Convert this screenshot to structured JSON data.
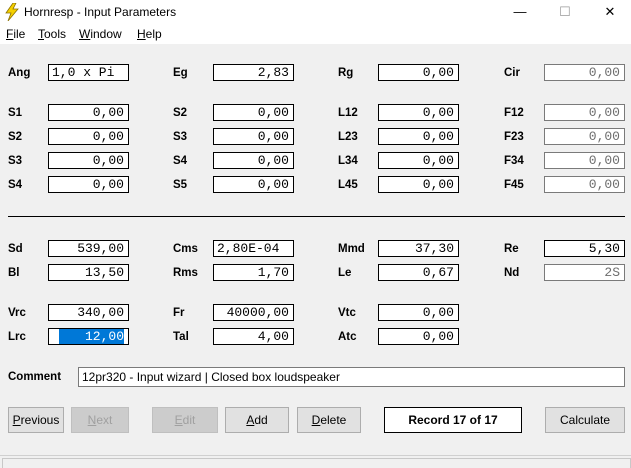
{
  "window": {
    "title": "Hornresp - Input Parameters",
    "minimize": "—",
    "maximize": "☐",
    "close": "✕"
  },
  "menu": [
    "File",
    "Tools",
    "Window",
    "Help"
  ],
  "params": {
    "Ang": {
      "label": "Ang",
      "value": "1,0 x Pi"
    },
    "Eg": {
      "label": "Eg",
      "value": "2,83"
    },
    "Rg": {
      "label": "Rg",
      "value": "0,00"
    },
    "Cir": {
      "label": "Cir",
      "value": "0,00"
    },
    "S1": {
      "label": "S1",
      "value": "0,00"
    },
    "S2a": {
      "label": "S2",
      "value": "0,00"
    },
    "L12": {
      "label": "L12",
      "value": "0,00"
    },
    "F12": {
      "label": "F12",
      "value": "0,00"
    },
    "S2b": {
      "label": "S2",
      "value": "0,00"
    },
    "S3a": {
      "label": "S3",
      "value": "0,00"
    },
    "L23": {
      "label": "L23",
      "value": "0,00"
    },
    "F23": {
      "label": "F23",
      "value": "0,00"
    },
    "S3b": {
      "label": "S3",
      "value": "0,00"
    },
    "S4a": {
      "label": "S4",
      "value": "0,00"
    },
    "L34": {
      "label": "L34",
      "value": "0,00"
    },
    "F34": {
      "label": "F34",
      "value": "0,00"
    },
    "S4b": {
      "label": "S4",
      "value": "0,00"
    },
    "S5": {
      "label": "S5",
      "value": "0,00"
    },
    "L45": {
      "label": "L45",
      "value": "0,00"
    },
    "F45": {
      "label": "F45",
      "value": "0,00"
    },
    "Sd": {
      "label": "Sd",
      "value": "539,00"
    },
    "Cms": {
      "label": "Cms",
      "value": "2,80E-04"
    },
    "Mmd": {
      "label": "Mmd",
      "value": "37,30"
    },
    "Re": {
      "label": "Re",
      "value": "5,30"
    },
    "Bl": {
      "label": "Bl",
      "value": "13,50"
    },
    "Rms": {
      "label": "Rms",
      "value": "1,70"
    },
    "Le": {
      "label": "Le",
      "value": "0,67"
    },
    "Nd": {
      "label": "Nd",
      "value": "2S"
    },
    "Vrc": {
      "label": "Vrc",
      "value": "340,00"
    },
    "Fr": {
      "label": "Fr",
      "value": "40000,00"
    },
    "Vtc": {
      "label": "Vtc",
      "value": "0,00"
    },
    "Lrc": {
      "label": "Lrc",
      "value": "12,00"
    },
    "Tal": {
      "label": "Tal",
      "value": "4,00"
    },
    "Atc": {
      "label": "Atc",
      "value": "0,00"
    }
  },
  "comment": {
    "label": "Comment",
    "value": "12pr320 - Input wizard | Closed box loudspeaker"
  },
  "buttons": {
    "previous": "Previous",
    "next": "Next",
    "edit": "Edit",
    "add": "Add",
    "delete": "Delete",
    "calculate": "Calculate"
  },
  "record": "Record 17 of 17",
  "colors": {
    "selection": "#0078d7",
    "disabled_text": "#6d6d6d",
    "background": "#f0f0f0"
  }
}
